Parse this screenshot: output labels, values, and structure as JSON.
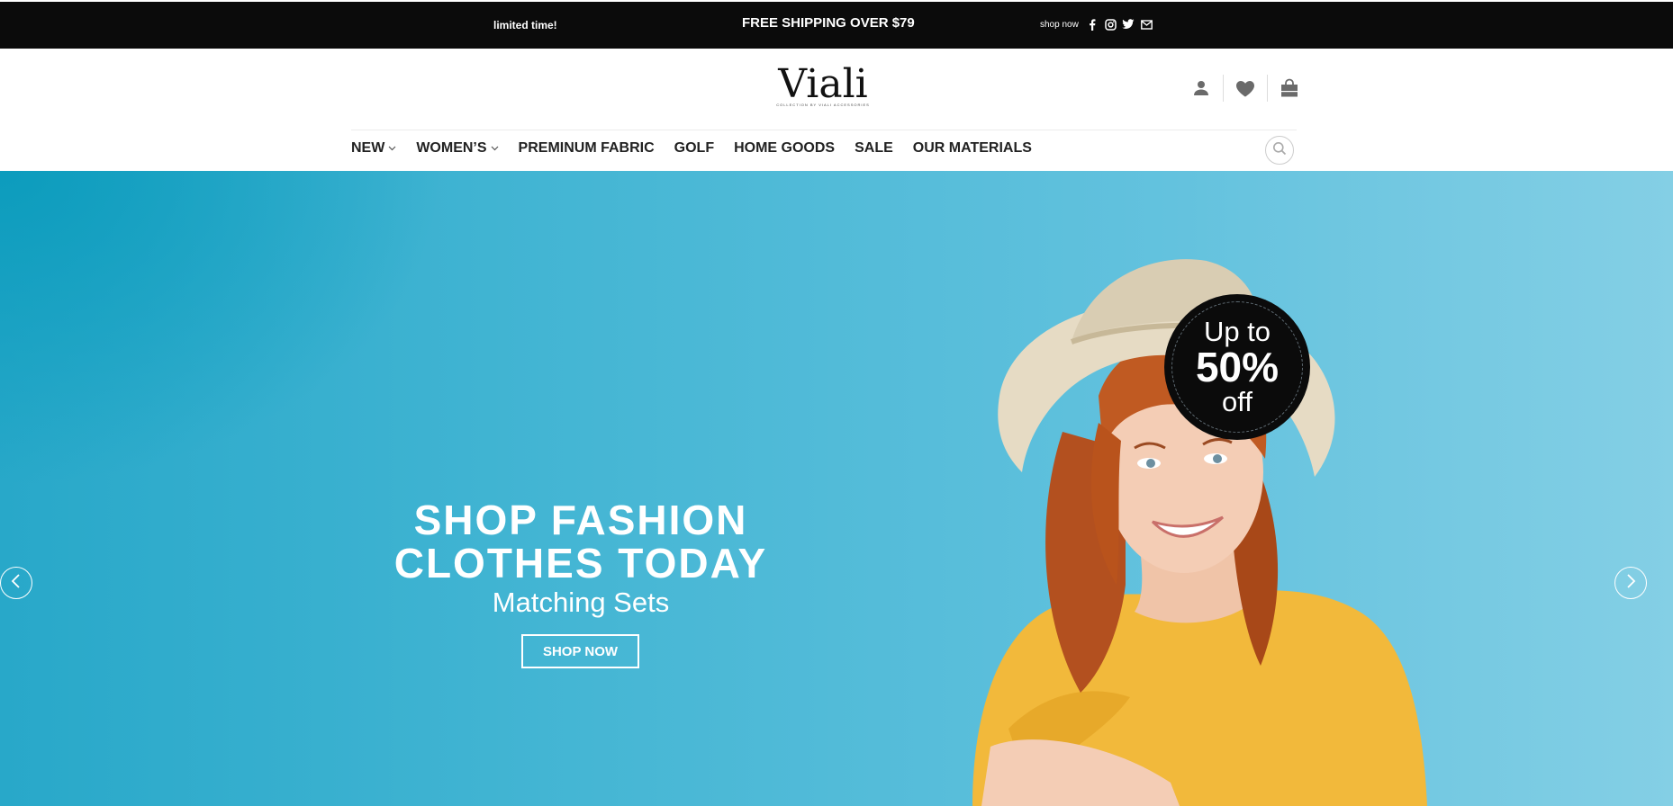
{
  "topbar": {
    "left_text": "limited time!",
    "center_text": "FREE SHIPPING OVER $79",
    "shop_now": "shop now",
    "social_icons": [
      "facebook-icon",
      "instagram-icon",
      "twitter-icon",
      "envelope-icon"
    ]
  },
  "header": {
    "logo_text": "Viali",
    "logo_tagline": "COLLECTION BY VIALI ACCESSORIES",
    "icons": [
      "user-icon",
      "heart-icon",
      "shopping-bag-icon"
    ]
  },
  "nav": {
    "items": [
      {
        "label": "NEW",
        "has_dropdown": true
      },
      {
        "label": "WOMEN’S",
        "has_dropdown": true
      },
      {
        "label": "PREMINUM FABRIC",
        "has_dropdown": false
      },
      {
        "label": "GOLF",
        "has_dropdown": false
      },
      {
        "label": "HOME GOODS",
        "has_dropdown": false
      },
      {
        "label": "SALE",
        "has_dropdown": false
      },
      {
        "label": "OUR MATERIALS",
        "has_dropdown": false
      }
    ],
    "search_icon": "search-icon"
  },
  "hero": {
    "headline_line1": "SHOP FASHION",
    "headline_line2": "CLOTHES TODAY",
    "subheadline": "Matching Sets",
    "button_label": "SHOP NOW",
    "badge": {
      "line1": "Up to",
      "line2": "50%",
      "line3": "off"
    },
    "arrows": [
      "chevron-left-icon",
      "chevron-right-icon"
    ]
  },
  "colors": {
    "topbar_bg": "#0b0b0b",
    "hero_bg": "#45b6d4",
    "badge_bg": "#0b0b0b",
    "text_dark": "#222222"
  }
}
